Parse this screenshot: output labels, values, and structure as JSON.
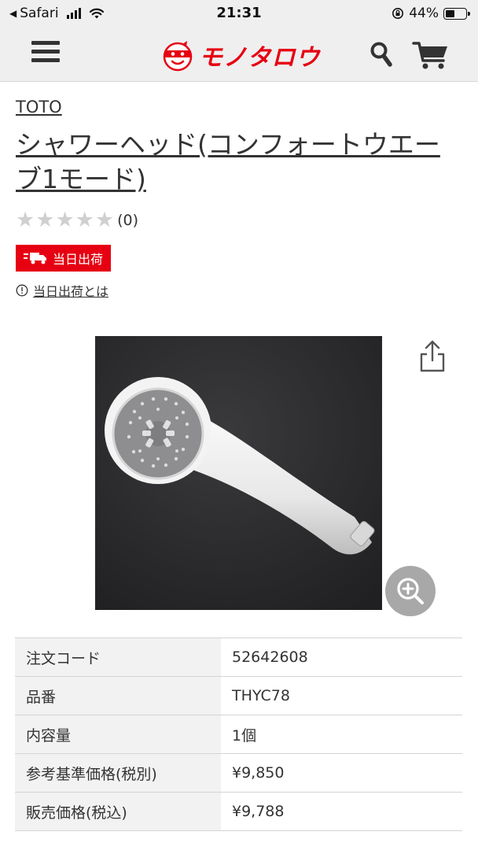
{
  "status_bar": {
    "back_app": "Safari",
    "time": "21:31",
    "battery": "44%",
    "battery_fraction": 0.44
  },
  "header": {
    "logo_text": "モノタロウ",
    "icons": [
      "menu-icon",
      "logo-icon",
      "search-icon",
      "cart-icon"
    ]
  },
  "product": {
    "brand": "TOTO",
    "title": "シャワーヘッド(コンフォートウエーブ1モード)",
    "rating": {
      "stars": 0,
      "max": 5,
      "count_text": "(0)"
    },
    "shipping_badge": "当日出荷",
    "shipping_info_link": "当日出荷とは"
  },
  "image": {
    "icons": [
      "share-icon",
      "zoom-in-icon"
    ]
  },
  "specs": [
    {
      "label": "注文コード",
      "value": "52642608"
    },
    {
      "label": "品番",
      "value": "THYC78"
    },
    {
      "label": "内容量",
      "value": "1個"
    },
    {
      "label": "参考基準価格(税別)",
      "value": "¥9,850"
    },
    {
      "label": "販売価格(税込)",
      "value": "¥9,788"
    }
  ],
  "colors": {
    "brand_red": "#e60012",
    "header_bg": "#efefef",
    "star_empty": "#d0d0d0",
    "zoom_button": "#a8a8a8"
  }
}
